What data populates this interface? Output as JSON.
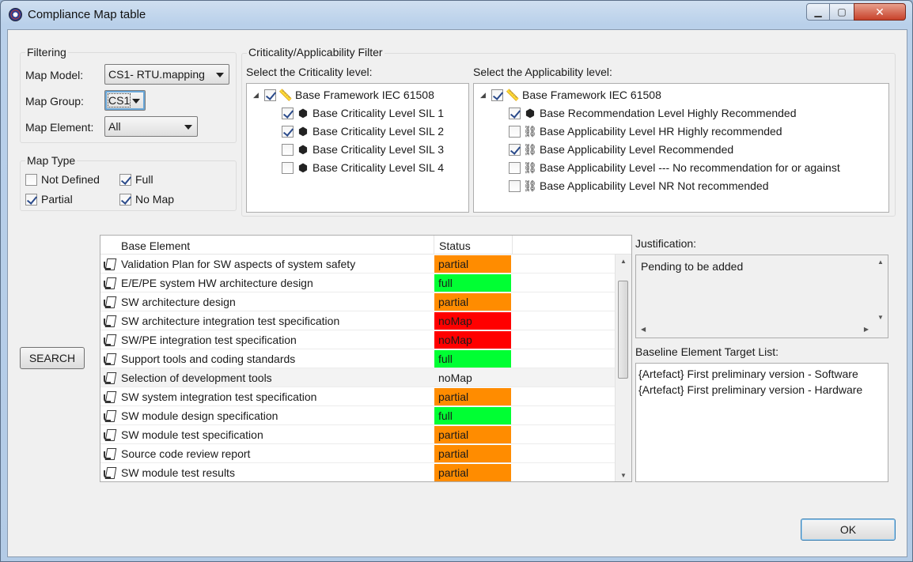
{
  "window": {
    "title": "Compliance Map table",
    "minimize_label": "▁",
    "maximize_label": "▢",
    "close_label": "✕"
  },
  "filtering": {
    "title": "Filtering",
    "map_model_label": "Map Model:",
    "map_model_value": "CS1- RTU.mapping",
    "map_group_label": "Map Group:",
    "map_group_value": "CS1",
    "map_element_label": "Map Element:",
    "map_element_value": "All"
  },
  "map_type": {
    "title": "Map Type",
    "items": [
      {
        "label": "Not Defined",
        "checked": false
      },
      {
        "label": "Full",
        "checked": true
      },
      {
        "label": "Partial",
        "checked": true
      },
      {
        "label": "No Map",
        "checked": true
      }
    ]
  },
  "criticality_filter": {
    "title": "Criticality/Applicability Filter",
    "criticality_label": "Select the Criticality level:",
    "applicability_label": "Select the Applicability level:",
    "criticality_tree": [
      {
        "label": "Base Framework IEC 61508",
        "checked": true,
        "icon": "ruler-icon",
        "level": 0
      },
      {
        "label": "Base Criticality Level SIL 1",
        "checked": true,
        "icon": "cube-icon",
        "level": 1
      },
      {
        "label": "Base Criticality Level SIL 2",
        "checked": true,
        "icon": "cube-icon",
        "level": 1
      },
      {
        "label": "Base Criticality Level SIL 3",
        "checked": false,
        "icon": "cube-icon",
        "level": 1
      },
      {
        "label": "Base Criticality Level SIL 4",
        "checked": false,
        "icon": "cube-icon",
        "level": 1
      }
    ],
    "applicability_tree": [
      {
        "label": "Base Framework IEC 61508",
        "checked": true,
        "icon": "ruler-icon",
        "level": 0
      },
      {
        "label": "Base Recommendation Level Highly Recommended",
        "checked": true,
        "icon": "cube-icon",
        "level": 1
      },
      {
        "label": "Base Applicability Level HR Highly recommended",
        "checked": false,
        "icon": "link-icon",
        "level": 1
      },
      {
        "label": "Base Applicability Level Recommended",
        "checked": true,
        "icon": "link-icon",
        "level": 1
      },
      {
        "label": "Base Applicability Level --- No recommendation for or against",
        "checked": false,
        "icon": "link-icon",
        "level": 1
      },
      {
        "label": "Base Applicability Level NR Not recommended",
        "checked": false,
        "icon": "link-icon",
        "level": 1
      }
    ]
  },
  "search_label": "SEARCH",
  "table": {
    "col_base_element": "Base Element",
    "col_status": "Status",
    "rows": [
      {
        "name": "Validation Plan for SW aspects of system safety",
        "status": "partial",
        "color": "#ff8c00"
      },
      {
        "name": "E/E/PE system HW architecture design",
        "status": "full",
        "color": "#00ff33"
      },
      {
        "name": "SW architecture design",
        "status": "partial",
        "color": "#ff8c00"
      },
      {
        "name": "SW architecture integration test specification",
        "status": "noMap",
        "color": "#ff0000"
      },
      {
        "name": "SW/PE integration test specification",
        "status": "noMap",
        "color": "#ff0000"
      },
      {
        "name": "Support tools and coding standards",
        "status": "full",
        "color": "#00ff33"
      },
      {
        "name": "Selection of development tools",
        "status": "noMap",
        "color": "#f3f3f3"
      },
      {
        "name": "SW system integration test specification",
        "status": "partial",
        "color": "#ff8c00"
      },
      {
        "name": "SW module design specification",
        "status": "full",
        "color": "#00ff33"
      },
      {
        "name": "SW module test specification",
        "status": "partial",
        "color": "#ff8c00"
      },
      {
        "name": "Source code review report",
        "status": "partial",
        "color": "#ff8c00"
      },
      {
        "name": "SW module test results",
        "status": "partial",
        "color": "#ff8c00"
      }
    ]
  },
  "justification": {
    "label": "Justification:",
    "text": "Pending to be added"
  },
  "baseline": {
    "label": "Baseline Element Target List:",
    "lines": [
      "{Artefact} First preliminary version - Software",
      "{Artefact} First preliminary version - Hardware"
    ]
  },
  "ok_label": "OK"
}
